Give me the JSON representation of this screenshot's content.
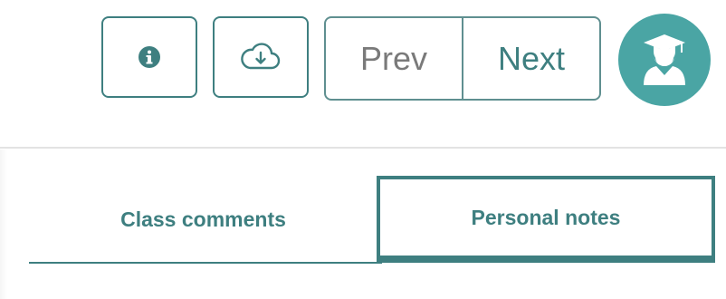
{
  "colors": {
    "accent": "#3e7f80",
    "avatar_bg": "#4aa5a4",
    "muted_text": "#7a7a7a"
  },
  "toolbar": {
    "info_icon": "info-icon",
    "download_icon": "cloud-download-icon",
    "prev_label": "Prev",
    "next_label": "Next",
    "avatar_icon": "graduate-user-icon"
  },
  "tabs": [
    {
      "label": "Class comments",
      "active": false
    },
    {
      "label": "Personal notes",
      "active": true
    }
  ]
}
